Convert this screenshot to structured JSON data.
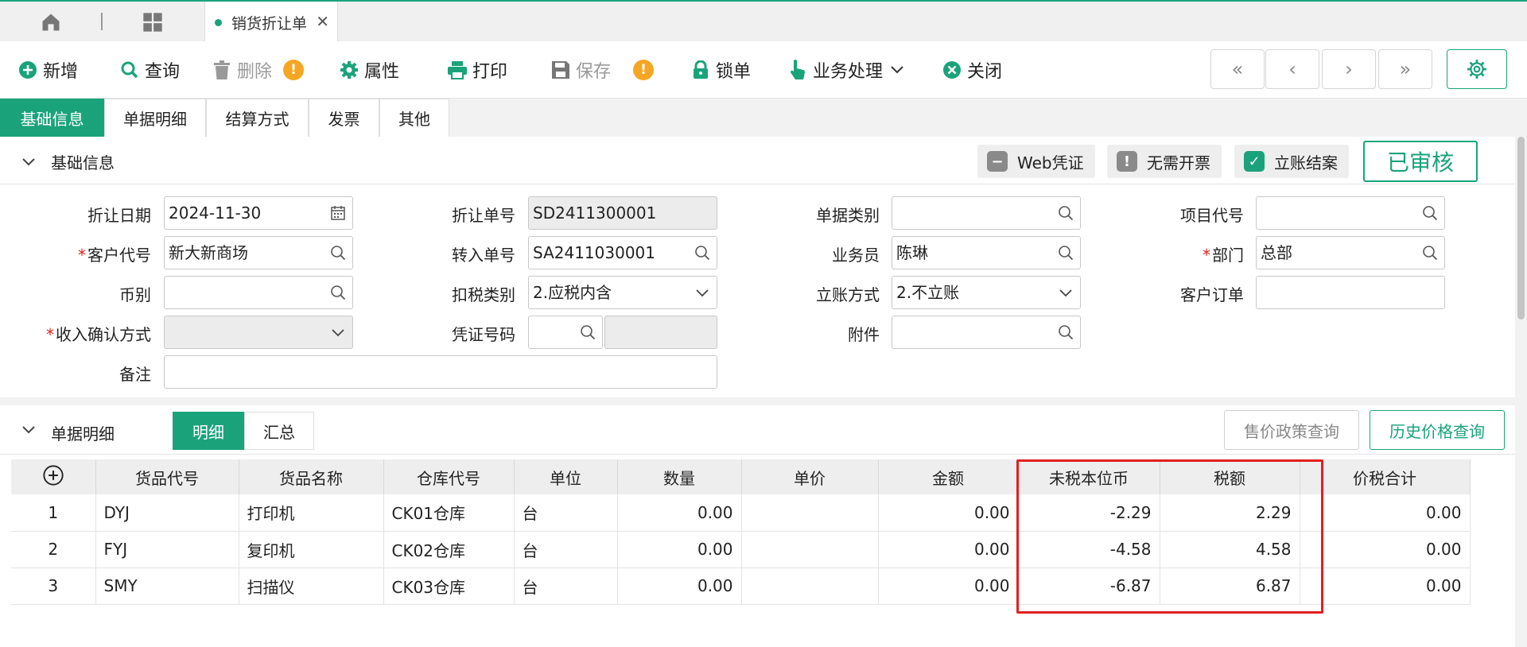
{
  "tabbar": {
    "active_tab": "销货折让单"
  },
  "toolbar": {
    "new": "新增",
    "query": "查询",
    "delete": "删除",
    "properties": "属性",
    "print": "打印",
    "save": "保存",
    "lock": "锁单",
    "business": "业务处理",
    "close": "关闭",
    "nav_first": "«",
    "nav_prev": "‹",
    "nav_next": "›",
    "nav_last": "»"
  },
  "section_tabs": [
    "基础信息",
    "单据明细",
    "结算方式",
    "发票",
    "其他"
  ],
  "basic": {
    "title": "基础信息",
    "web_voucher": "Web凭证",
    "no_invoice": "无需开票",
    "settle": "立账结案",
    "status": "已审核",
    "fields": {
      "discount_date": {
        "label": "折让日期",
        "value": "2024-11-30"
      },
      "discount_no": {
        "label": "折让单号",
        "value": "SD2411300001"
      },
      "doc_type": {
        "label": "单据类别",
        "value": ""
      },
      "project_code": {
        "label": "项目代号",
        "value": ""
      },
      "customer_code": {
        "label": "客户代号",
        "value": "新大新商场"
      },
      "transfer_no": {
        "label": "转入单号",
        "value": "SA2411030001"
      },
      "salesperson": {
        "label": "业务员",
        "value": "陈琳"
      },
      "department": {
        "label": "部门",
        "value": "总部"
      },
      "currency": {
        "label": "币别",
        "value": ""
      },
      "tax_type": {
        "label": "扣税类别",
        "value": "2.应税内含"
      },
      "account_method": {
        "label": "立账方式",
        "value": "2.不立账"
      },
      "customer_order": {
        "label": "客户订单",
        "value": ""
      },
      "revenue_method": {
        "label": "收入确认方式",
        "value": ""
      },
      "voucher_no": {
        "label": "凭证号码",
        "value": ""
      },
      "attachment": {
        "label": "附件",
        "value": ""
      },
      "remark": {
        "label": "备注",
        "value": ""
      }
    }
  },
  "detail": {
    "title": "单据明细",
    "view_detail": "明细",
    "view_summary": "汇总",
    "price_policy_btn": "售价政策查询",
    "history_price_btn": "历史价格查询",
    "columns": [
      "货品代号",
      "货品名称",
      "仓库代号",
      "单位",
      "数量",
      "单价",
      "金额",
      "未税本位币",
      "税额",
      "价税合计"
    ],
    "rows": [
      {
        "idx": "1",
        "code": "DYJ",
        "name": "打印机",
        "wh": "CK01仓库",
        "unit": "台",
        "qty": "0.00",
        "price": "",
        "amount": "0.00",
        "pretax": "-2.29",
        "tax": "2.29",
        "total": "0.00"
      },
      {
        "idx": "2",
        "code": "FYJ",
        "name": "复印机",
        "wh": "CK02仓库",
        "unit": "台",
        "qty": "0.00",
        "price": "",
        "amount": "0.00",
        "pretax": "-4.58",
        "tax": "4.58",
        "total": "0.00"
      },
      {
        "idx": "3",
        "code": "SMY",
        "name": "扫描仪",
        "wh": "CK03仓库",
        "unit": "台",
        "qty": "0.00",
        "price": "",
        "amount": "0.00",
        "pretax": "-6.87",
        "tax": "6.87",
        "total": "0.00"
      }
    ]
  },
  "colors": {
    "accent": "#1aa37a",
    "warning": "#f5a623",
    "highlight": "#e02020"
  },
  "icons": [
    "home-icon",
    "grid-icon",
    "plus-circle-icon",
    "search-icon",
    "trash-icon",
    "gear-icon",
    "printer-icon",
    "floppy-icon",
    "lock-icon",
    "pointer-hand-icon",
    "close-circle-icon",
    "settings-icon",
    "calendar-icon",
    "chevron-down-icon"
  ]
}
